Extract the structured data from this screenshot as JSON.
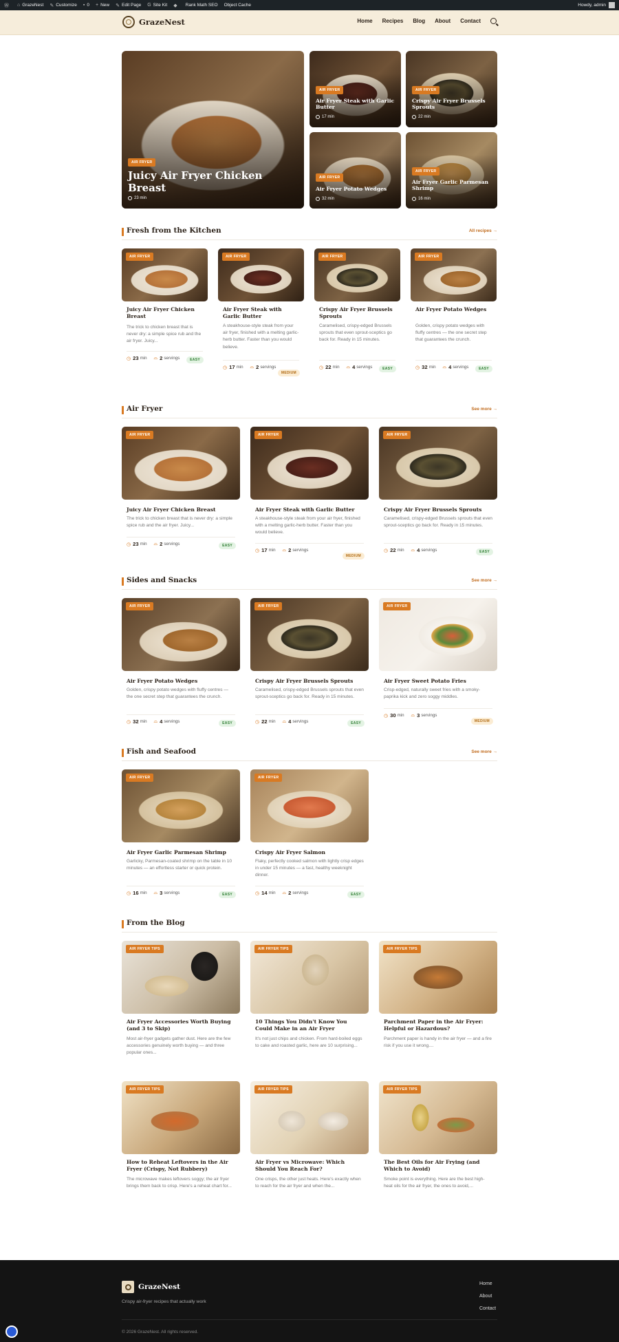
{
  "adminbar": {
    "site": "GrazeNest",
    "customize": "Customize",
    "comments": "0",
    "new": "New",
    "edit": "Edit Page",
    "sitekit": "Site Kit",
    "rankmath": "Rank Math SEO",
    "objcache": "Object Cache",
    "howdy": "Howdy, admin"
  },
  "header": {
    "logo": "GrazeNest",
    "nav": [
      "Home",
      "Recipes",
      "Blog",
      "About",
      "Contact"
    ]
  },
  "hero": [
    {
      "badge": "AIR FRYER",
      "title": "Juicy Air Fryer Chicken Breast",
      "time": "23 min"
    },
    {
      "badge": "AIR FRYER",
      "title": "Air Fryer Steak with Garlic Butter",
      "time": "17 min"
    },
    {
      "badge": "AIR FRYER",
      "title": "Crispy Air Fryer Brussels Sprouts",
      "time": "22 min"
    },
    {
      "badge": "AIR FRYER",
      "title": "Air Fryer Potato Wedges",
      "time": "32 min"
    },
    {
      "badge": "AIR FRYER",
      "title": "Air Fryer Garlic Parmesan Shrimp",
      "time": "16 min"
    }
  ],
  "sections": {
    "fresh": {
      "title": "Fresh from the Kitchen",
      "link": "All recipes →",
      "cards": [
        {
          "badge": "AIR FRYER",
          "title": "Juicy Air Fryer Chicken Breast",
          "desc": "The trick to chicken breast that is never dry: a simple spice rub and the air fryer. Juicy...",
          "time": "23",
          "servings": "2",
          "difficulty": "EASY"
        },
        {
          "badge": "AIR FRYER",
          "title": "Air Fryer Steak with Garlic Butter",
          "desc": "A steakhouse-style steak from your air fryer, finished with a melting garlic-herb butter. Faster than you would believe.",
          "time": "17",
          "servings": "2",
          "difficulty": "MEDIUM"
        },
        {
          "badge": "AIR FRYER",
          "title": "Crispy Air Fryer Brussels Sprouts",
          "desc": "Caramelised, crispy-edged Brussels sprouts that even sprout-sceptics go back for. Ready in 15 minutes.",
          "time": "22",
          "servings": "4",
          "difficulty": "EASY"
        },
        {
          "badge": "AIR FRYER",
          "title": "Air Fryer Potato Wedges",
          "desc": "Golden, crispy potato wedges with fluffy centres — the one secret step that guarantees the crunch.",
          "time": "32",
          "servings": "4",
          "difficulty": "EASY"
        }
      ]
    },
    "airfryer": {
      "title": "Air Fryer",
      "link": "See more →",
      "cards": [
        {
          "badge": "AIR FRYER",
          "title": "Juicy Air Fryer Chicken Breast",
          "desc": "The trick to chicken breast that is never dry: a simple spice rub and the air fryer. Juicy...",
          "time": "23",
          "servings": "2",
          "difficulty": "EASY"
        },
        {
          "badge": "AIR FRYER",
          "title": "Air Fryer Steak with Garlic Butter",
          "desc": "A steakhouse-style steak from your air fryer, finished with a melting garlic-herb butter. Faster than you would believe.",
          "time": "17",
          "servings": "2",
          "difficulty": "MEDIUM"
        },
        {
          "badge": "AIR FRYER",
          "title": "Crispy Air Fryer Brussels Sprouts",
          "desc": "Caramelised, crispy-edged Brussels sprouts that even sprout-sceptics go back for. Ready in 15 minutes.",
          "time": "22",
          "servings": "4",
          "difficulty": "EASY"
        }
      ]
    },
    "sides": {
      "title": "Sides and Snacks",
      "link": "See more →",
      "cards": [
        {
          "badge": "AIR FRYER",
          "title": "Air Fryer Potato Wedges",
          "desc": "Golden, crispy potato wedges with fluffy centres — the one secret step that guarantees the crunch.",
          "time": "32",
          "servings": "4",
          "difficulty": "EASY"
        },
        {
          "badge": "AIR FRYER",
          "title": "Crispy Air Fryer Brussels Sprouts",
          "desc": "Caramelised, crispy-edged Brussels sprouts that even sprout-sceptics go back for. Ready in 15 minutes.",
          "time": "22",
          "servings": "4",
          "difficulty": "EASY"
        },
        {
          "badge": "AIR FRYER",
          "title": "Air Fryer Sweet Potato Fries",
          "desc": "Crisp-edged, naturally sweet fries with a smoky-paprika kick and zero soggy middles.",
          "time": "30",
          "servings": "3",
          "difficulty": "MEDIUM"
        }
      ]
    },
    "fish": {
      "title": "Fish and Seafood",
      "link": "See more →",
      "cards": [
        {
          "badge": "AIR FRYER",
          "title": "Air Fryer Garlic Parmesan Shrimp",
          "desc": "Garlicky, Parmesan-coated shrimp on the table in 10 minutes — an effortless starter or quick protein.",
          "time": "16",
          "servings": "3",
          "difficulty": "EASY"
        },
        {
          "badge": "AIR FRYER",
          "title": "Crispy Air Fryer Salmon",
          "desc": "Flaky, perfectly cooked salmon with lightly crisp edges in under 15 minutes — a fast, healthy weeknight dinner.",
          "time": "14",
          "servings": "2",
          "difficulty": "EASY"
        }
      ]
    },
    "blog": {
      "title": "From the Blog",
      "cards": [
        {
          "badge": "AIR FRYER TIPS",
          "title": "Air Fryer Accessories Worth Buying (and 3 to Skip)",
          "desc": "Most air-fryer gadgets gather dust. Here are the few accessories genuinely worth buying — and three popular ones..."
        },
        {
          "badge": "AIR FRYER TIPS",
          "title": "10 Things You Didn't Know You Could Make in an Air Fryer",
          "desc": "It's not just chips and chicken. From hard-boiled eggs to cake and roasted garlic, here are 10 surprising..."
        },
        {
          "badge": "AIR FRYER TIPS",
          "title": "Parchment Paper in the Air Fryer: Helpful or Hazardous?",
          "desc": "Parchment paper is handy in the air fryer — and a fire risk if you use it wrong...."
        },
        {
          "badge": "AIR FRYER TIPS",
          "title": "How to Reheat Leftovers in the Air Fryer (Crispy, Not Rubbery)",
          "desc": "The microwave makes leftovers soggy; the air fryer brings them back to crisp. Here's a reheat chart for..."
        },
        {
          "badge": "AIR FRYER TIPS",
          "title": "Air Fryer vs Microwave: Which Should You Reach For?",
          "desc": "One crisps, the other just heats. Here's exactly when to reach for the air fryer and when the..."
        },
        {
          "badge": "AIR FRYER TIPS",
          "title": "The Best Oils for Air Frying (and Which to Avoid)",
          "desc": "Smoke point is everything. Here are the best high-heat oils for the air fryer, the ones to avoid,..."
        }
      ]
    }
  },
  "labels": {
    "min": "min",
    "servings": "servings"
  },
  "footer": {
    "logo": "GrazeNest",
    "tagline": "Crispy air-fryer recipes that actually work",
    "links": [
      "Home",
      "About",
      "Contact"
    ],
    "copyright": "© 2026 GrazeNest. All rights reserved."
  },
  "colors": {
    "accent": "#d97a22",
    "header_bg": "#f6eddb",
    "footer_bg": "#141414"
  }
}
